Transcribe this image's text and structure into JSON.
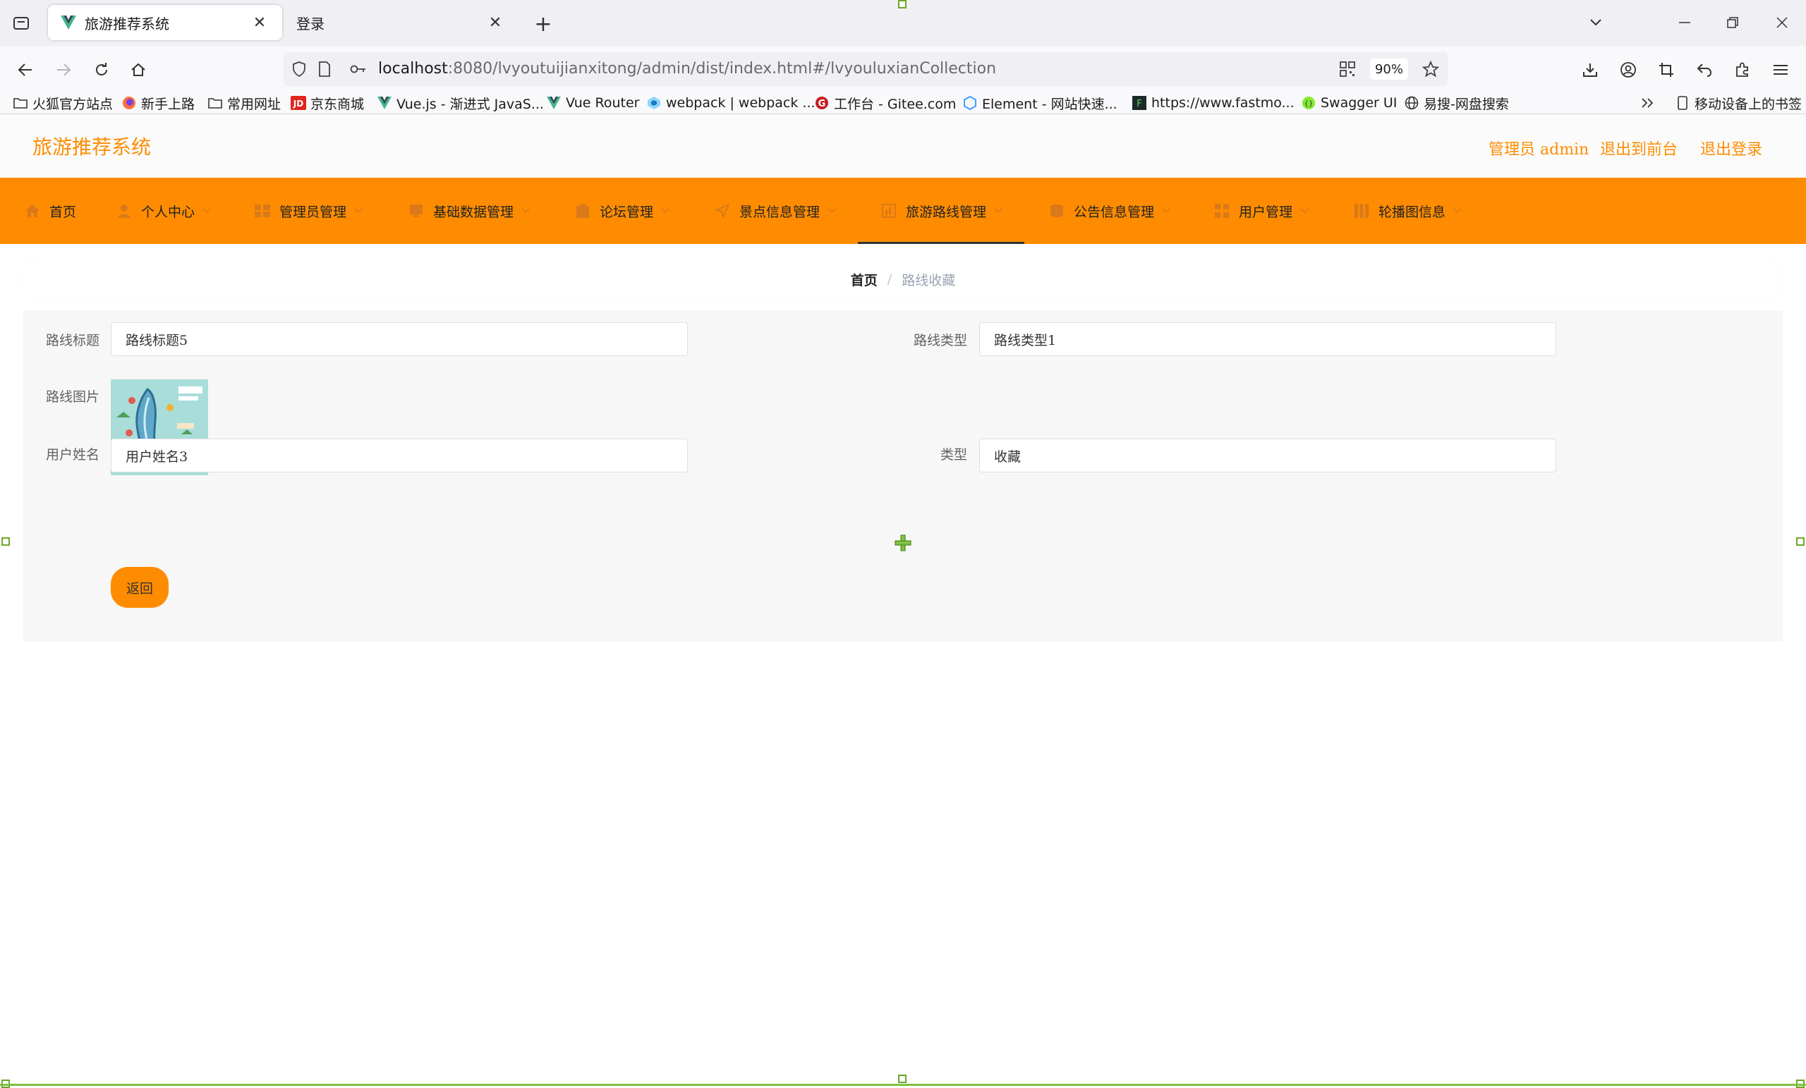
{
  "browser": {
    "tabs": [
      {
        "title": "旅游推荐系统",
        "active": true
      },
      {
        "title": "登录",
        "active": false
      }
    ],
    "url_host": "localhost",
    "url_rest": ":8080/lvyoutuijianxitong/admin/dist/index.html#/lvyouluxianCollection",
    "zoom": "90%",
    "bookmarks": [
      {
        "label": "火狐官方站点",
        "icon": "folder-icon"
      },
      {
        "label": "新手上路",
        "icon": "firefox-icon"
      },
      {
        "label": "常用网址",
        "icon": "folder-icon"
      },
      {
        "label": "京东商城",
        "icon": "jd-icon"
      },
      {
        "label": "Vue.js - 渐进式 JavaS...",
        "icon": "vue-icon"
      },
      {
        "label": "Vue Router",
        "icon": "vue-icon"
      },
      {
        "label": "webpack | webpack ...",
        "icon": "webpack-icon"
      },
      {
        "label": "工作台 - Gitee.com",
        "icon": "gitee-icon"
      },
      {
        "label": "Element - 网站快速...",
        "icon": "element-icon"
      },
      {
        "label": "https://www.fastmo...",
        "icon": "fastmock-icon"
      },
      {
        "label": "Swagger UI",
        "icon": "swagger-icon"
      },
      {
        "label": "易搜-网盘搜索",
        "icon": "globe-icon"
      }
    ],
    "mobile_bookmarks": "移动设备上的书签"
  },
  "app": {
    "title": "旅游推荐系统",
    "header_links": [
      "管理员 admin",
      "退出到前台",
      "退出登录"
    ],
    "menu": [
      {
        "label": "首页",
        "icon": "home-icon",
        "has_caret": false
      },
      {
        "label": "个人中心",
        "icon": "user-icon",
        "has_caret": true
      },
      {
        "label": "管理员管理",
        "icon": "admin-icon",
        "has_caret": true
      },
      {
        "label": "基础数据管理",
        "icon": "data-icon",
        "has_caret": true
      },
      {
        "label": "论坛管理",
        "icon": "forum-icon",
        "has_caret": true
      },
      {
        "label": "景点信息管理",
        "icon": "location-icon",
        "has_caret": true
      },
      {
        "label": "旅游路线管理",
        "icon": "route-icon",
        "has_caret": true,
        "active": true
      },
      {
        "label": "公告信息管理",
        "icon": "notice-icon",
        "has_caret": true
      },
      {
        "label": "用户管理",
        "icon": "users-icon",
        "has_caret": true
      },
      {
        "label": "轮播图信息",
        "icon": "carousel-icon",
        "has_caret": true
      }
    ],
    "breadcrumb": {
      "home": "首页",
      "separator": "/",
      "current": "路线收藏"
    },
    "form": {
      "route_title_label": "路线标题",
      "route_title_value": "路线标题5",
      "route_type_label": "路线类型",
      "route_type_value": "路线类型1",
      "route_image_label": "路线图片",
      "user_name_label": "用户姓名",
      "user_name_value": "用户姓名3",
      "type_label": "类型",
      "type_value": "收藏",
      "back_button": "返回"
    },
    "colors": {
      "accent": "#ff8c00",
      "header_bg": "#fbfbfb",
      "card_bg": "#f7f7f7"
    }
  }
}
